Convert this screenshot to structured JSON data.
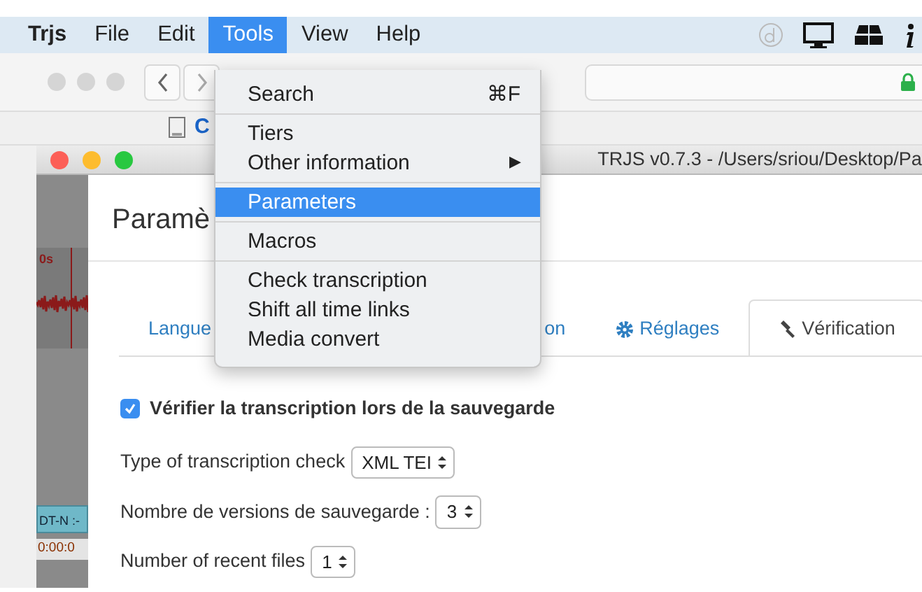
{
  "menubar": {
    "items": [
      {
        "label": "Trjs",
        "selected": false
      },
      {
        "label": "File",
        "selected": false
      },
      {
        "label": "Edit",
        "selected": false
      },
      {
        "label": "Tools",
        "selected": true
      },
      {
        "label": "View",
        "selected": false
      },
      {
        "label": "Help",
        "selected": false
      }
    ]
  },
  "bookmark": {
    "label": "C"
  },
  "app_window": {
    "title": "TRJS v0.7.3 - /Users/sriou/Desktop/Pa"
  },
  "track": {
    "time_mark": "0s",
    "tier_label": "DT-N :-",
    "timecode": "0:00:0"
  },
  "dialog": {
    "title": "Paramè",
    "tabs": [
      {
        "label": "Langue",
        "kind": "plain",
        "selected": false
      },
      {
        "label": "on",
        "kind": "plain",
        "selected": false
      },
      {
        "label": "Réglages",
        "kind": "gear",
        "selected": false
      },
      {
        "label": "Vérification",
        "kind": "hammer",
        "selected": true
      }
    ],
    "check": {
      "label": "Vérifier la transcription lors de la sauvegarde",
      "checked": true
    },
    "fields": [
      {
        "label": "Type of transcription check",
        "value": "XML TEI"
      },
      {
        "label": "Nombre de versions de sauvegarde :",
        "value": "3"
      },
      {
        "label": "Number of recent files",
        "value": "1"
      }
    ]
  },
  "menu": {
    "groups": [
      [
        {
          "label": "Search",
          "shortcut": "⌘F",
          "selected": false
        }
      ],
      [
        {
          "label": "Tiers",
          "selected": false
        },
        {
          "label": "Other information",
          "submenu": "▶",
          "selected": false
        }
      ],
      [
        {
          "label": "Parameters",
          "selected": true
        }
      ],
      [
        {
          "label": "Macros",
          "selected": false
        }
      ],
      [
        {
          "label": "Check transcription",
          "selected": false
        },
        {
          "label": "Shift all time links",
          "selected": false
        },
        {
          "label": "Media convert",
          "selected": false
        }
      ]
    ]
  }
}
